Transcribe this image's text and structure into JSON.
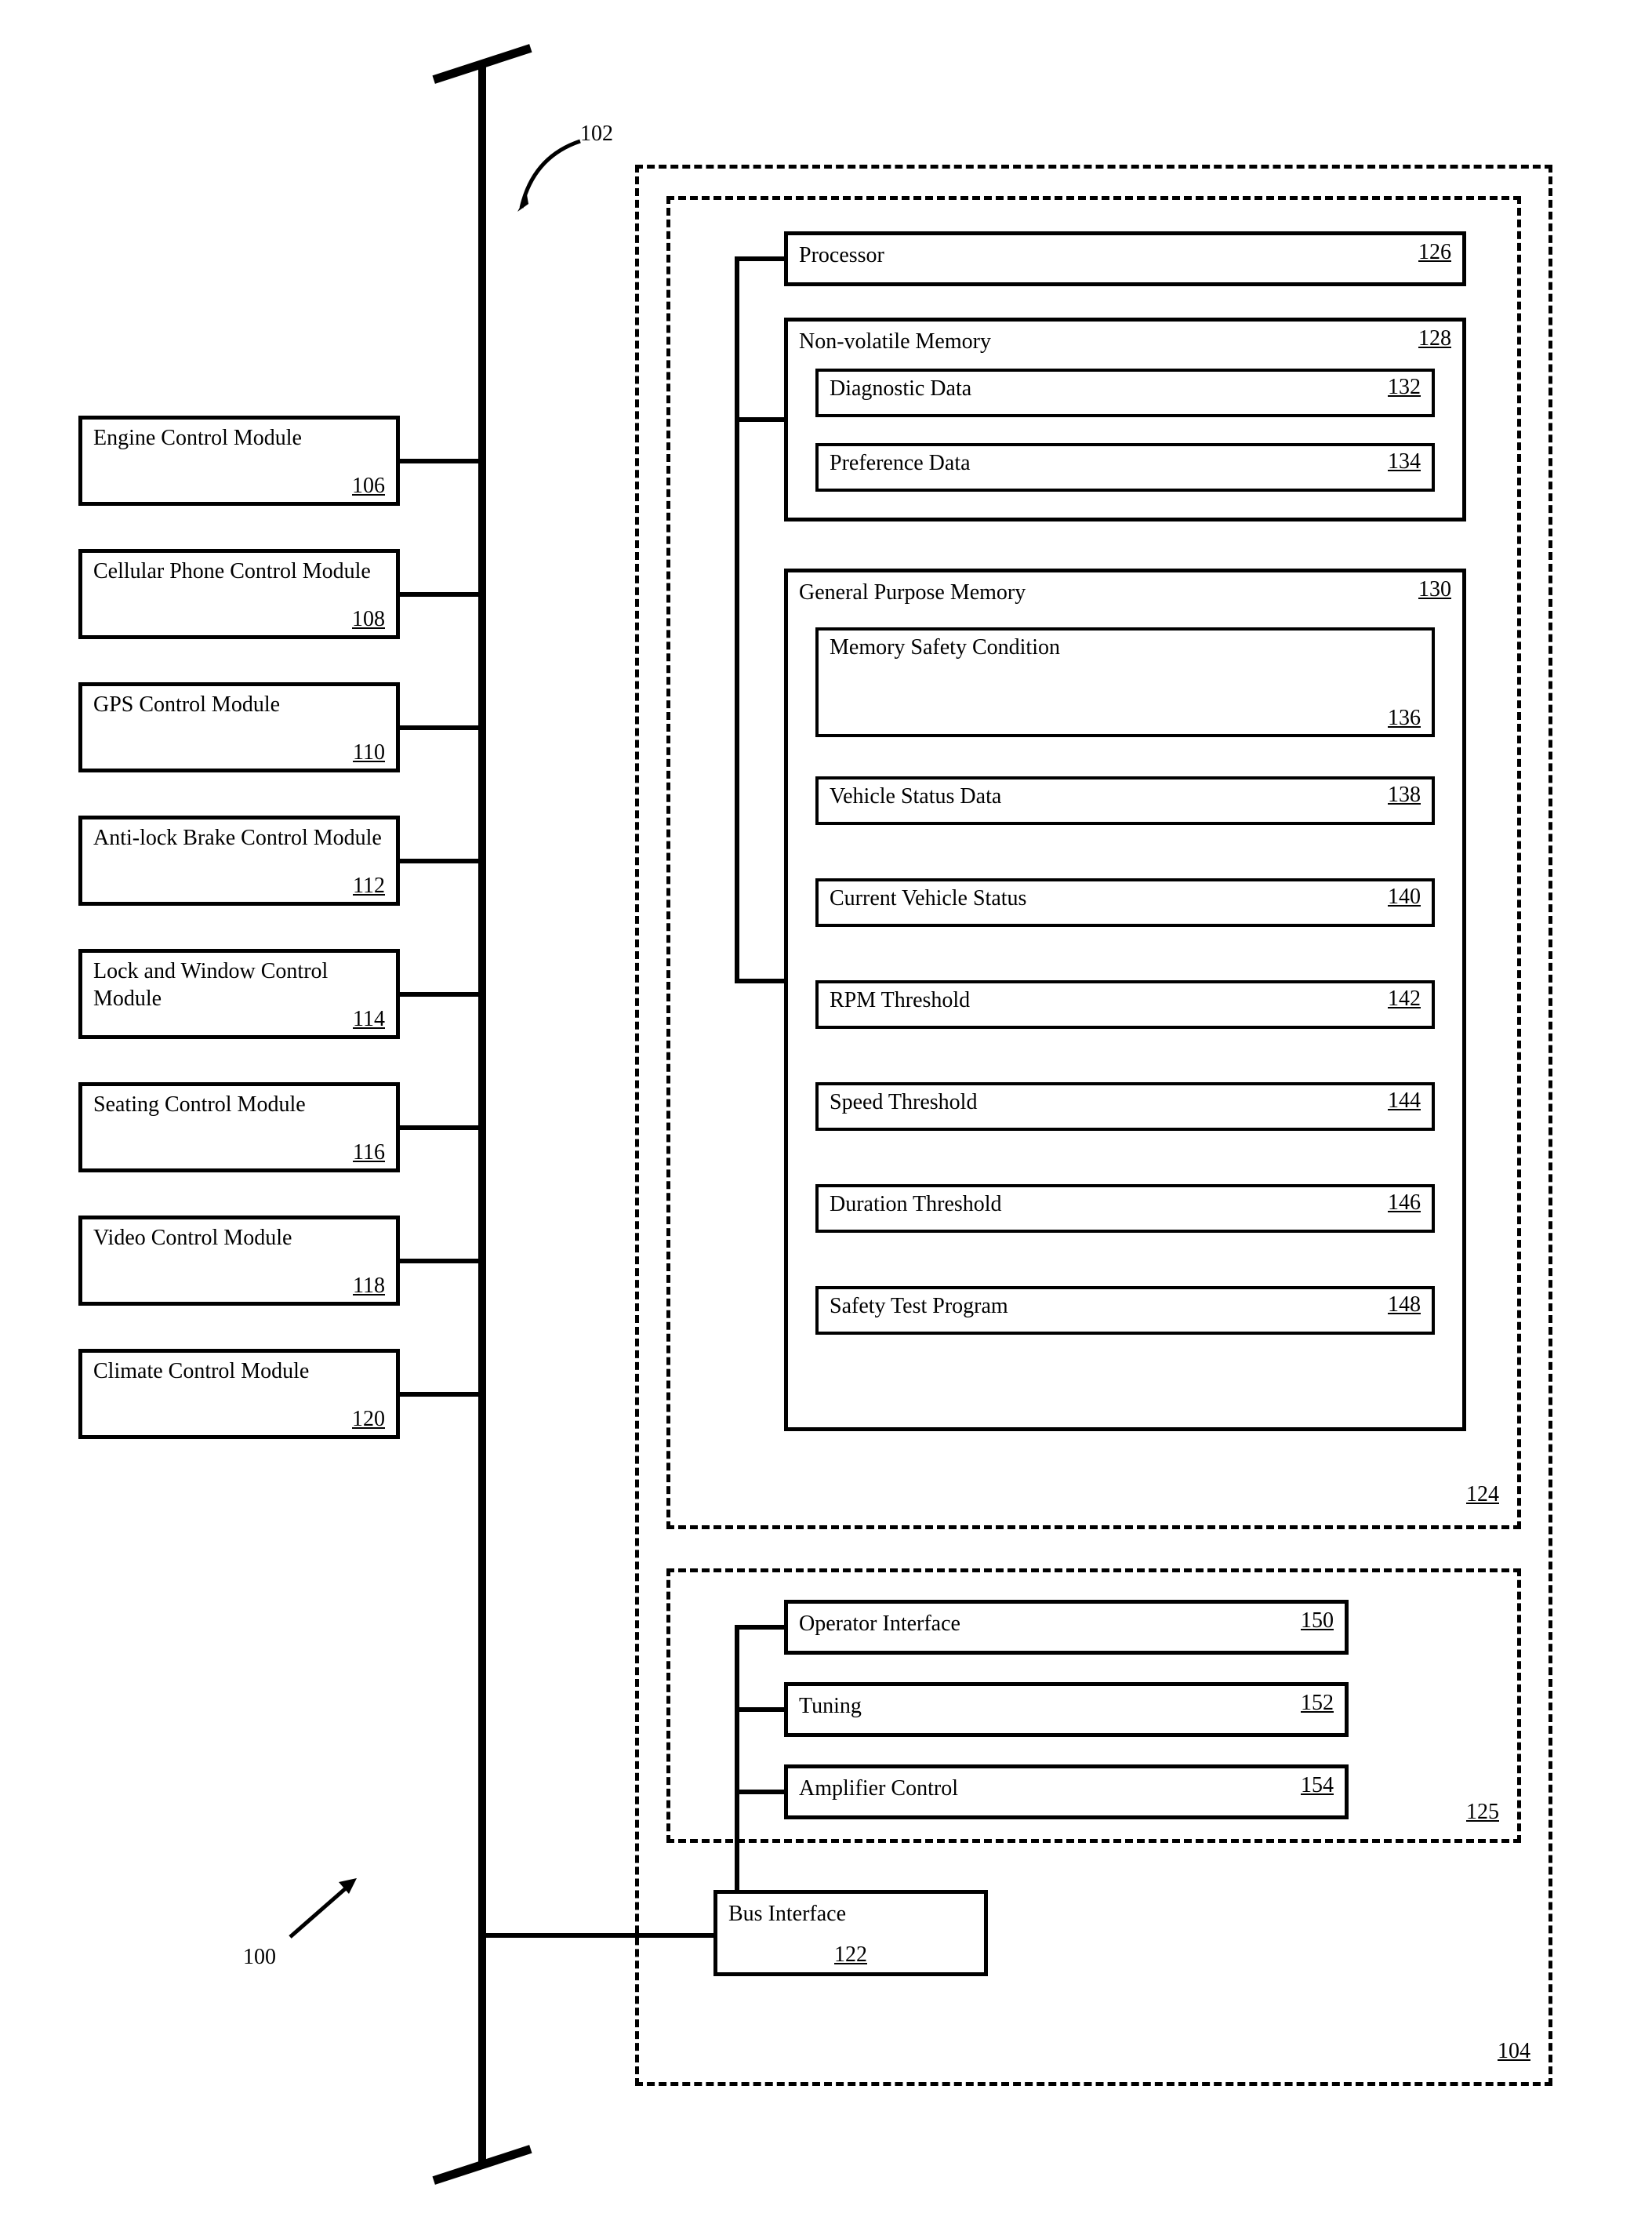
{
  "bus_ref": "102",
  "figure_ref": "100",
  "left_modules": [
    {
      "label": "Engine Control Module",
      "ref": "106"
    },
    {
      "label": "Cellular Phone Control Module",
      "ref": "108"
    },
    {
      "label": "GPS Control Module",
      "ref": "110"
    },
    {
      "label": "Anti-lock Brake Control Module",
      "ref": "112"
    },
    {
      "label": "Lock and Window Control Module",
      "ref": "114"
    },
    {
      "label": "Seating Control Module",
      "ref": "116"
    },
    {
      "label": "Video Control Module",
      "ref": "118"
    },
    {
      "label": "Climate Control Module",
      "ref": "120"
    }
  ],
  "outer_container_ref": "104",
  "group_124_ref": "124",
  "group_125_ref": "125",
  "processor": {
    "label": "Processor",
    "ref": "126"
  },
  "nvmem": {
    "label": "Non-volatile Memory",
    "ref": "128",
    "children": [
      {
        "label": "Diagnostic Data",
        "ref": "132"
      },
      {
        "label": "Preference Data",
        "ref": "134"
      }
    ]
  },
  "gpmem": {
    "label": "General Purpose Memory",
    "ref": "130",
    "children": [
      {
        "label": "Memory Safety Condition",
        "ref": "136"
      },
      {
        "label": "Vehicle Status Data",
        "ref": "138"
      },
      {
        "label": "Current Vehicle Status",
        "ref": "140"
      },
      {
        "label": "RPM Threshold",
        "ref": "142"
      },
      {
        "label": "Speed Threshold",
        "ref": "144"
      },
      {
        "label": "Duration Threshold",
        "ref": "146"
      },
      {
        "label": "Safety Test Program",
        "ref": "148"
      }
    ]
  },
  "group_125_items": [
    {
      "label": "Operator Interface",
      "ref": "150"
    },
    {
      "label": "Tuning",
      "ref": "152"
    },
    {
      "label": "Amplifier Control",
      "ref": "154"
    }
  ],
  "bus_interface": {
    "label": "Bus Interface",
    "ref": "122"
  }
}
